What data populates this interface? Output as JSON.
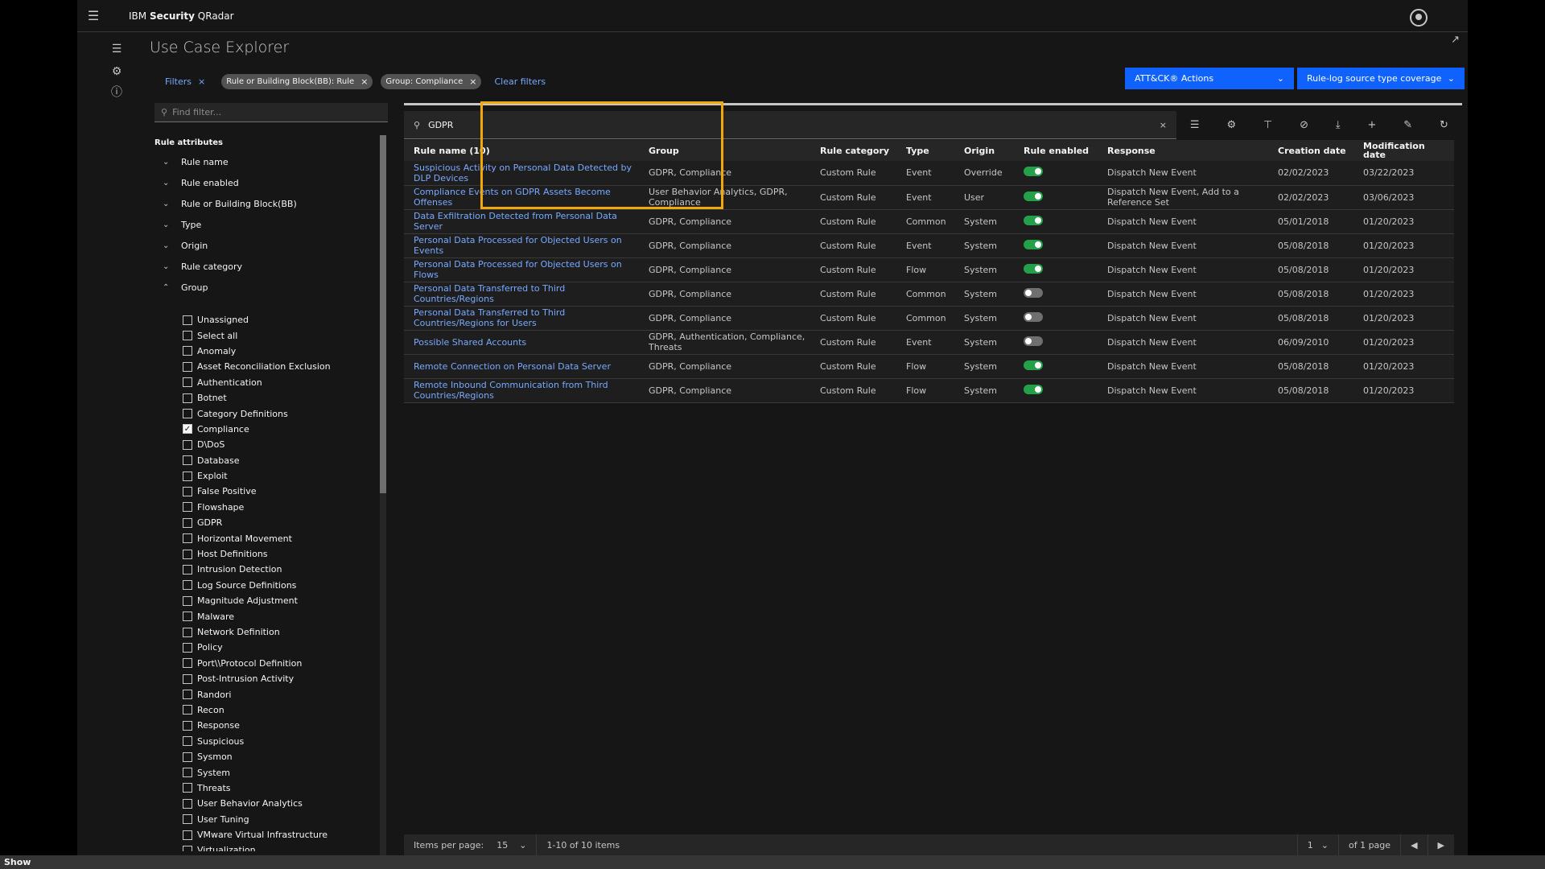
{
  "header": {
    "brand_prefix": "IBM ",
    "brand_bold": "Security",
    "brand_suffix": " QRadar"
  },
  "page": {
    "title": "Use Case Explorer"
  },
  "filters": {
    "label": "Filters",
    "tags": [
      "Rule or Building Block(BB): Rule",
      "Group: Compliance"
    ],
    "clear": "Clear filters"
  },
  "actions": {
    "attack": "ATT&CK® Actions",
    "coverage": "Rule-log source type coverage"
  },
  "sidebar": {
    "find_placeholder": "Find filter...",
    "title": "Rule attributes",
    "attributes": [
      "Rule name",
      "Rule enabled",
      "Rule or Building Block(BB)",
      "Type",
      "Origin",
      "Rule category",
      "Group"
    ],
    "groups": [
      {
        "label": "Unassigned",
        "checked": false
      },
      {
        "label": "Select all",
        "checked": false
      },
      {
        "label": "Anomaly",
        "checked": false
      },
      {
        "label": "Asset Reconciliation Exclusion",
        "checked": false
      },
      {
        "label": "Authentication",
        "checked": false
      },
      {
        "label": "Botnet",
        "checked": false
      },
      {
        "label": "Category Definitions",
        "checked": false
      },
      {
        "label": "Compliance",
        "checked": true
      },
      {
        "label": "D\\DoS",
        "checked": false
      },
      {
        "label": "Database",
        "checked": false
      },
      {
        "label": "Exploit",
        "checked": false
      },
      {
        "label": "False Positive",
        "checked": false
      },
      {
        "label": "Flowshape",
        "checked": false
      },
      {
        "label": "GDPR",
        "checked": false
      },
      {
        "label": "Horizontal Movement",
        "checked": false
      },
      {
        "label": "Host Definitions",
        "checked": false
      },
      {
        "label": "Intrusion Detection",
        "checked": false
      },
      {
        "label": "Log Source Definitions",
        "checked": false
      },
      {
        "label": "Magnitude Adjustment",
        "checked": false
      },
      {
        "label": "Malware",
        "checked": false
      },
      {
        "label": "Network Definition",
        "checked": false
      },
      {
        "label": "Policy",
        "checked": false
      },
      {
        "label": "Port\\\\Protocol Definition",
        "checked": false
      },
      {
        "label": "Post-Intrusion Activity",
        "checked": false
      },
      {
        "label": "Randori",
        "checked": false
      },
      {
        "label": "Recon",
        "checked": false
      },
      {
        "label": "Response",
        "checked": false
      },
      {
        "label": "Suspicious",
        "checked": false
      },
      {
        "label": "Sysmon",
        "checked": false
      },
      {
        "label": "System",
        "checked": false
      },
      {
        "label": "Threats",
        "checked": false
      },
      {
        "label": "User Behavior Analytics",
        "checked": false
      },
      {
        "label": "User Tuning",
        "checked": false
      },
      {
        "label": "VMware Virtual Infrastructure",
        "checked": false
      },
      {
        "label": "Virtualization",
        "checked": false
      }
    ]
  },
  "search": {
    "value": "GDPR"
  },
  "table": {
    "columns": [
      "Rule name (10)",
      "Group",
      "Rule category",
      "Type",
      "Origin",
      "Rule enabled",
      "Response",
      "Creation date",
      "Modification date"
    ],
    "rows": [
      {
        "name": "Suspicious Activity on Personal Data Detected by DLP Devices",
        "group": "GDPR, Compliance",
        "category": "Custom Rule",
        "type": "Event",
        "origin": "Override",
        "enabled": true,
        "response": "Dispatch New Event",
        "created": "02/02/2023",
        "modified": "03/22/2023"
      },
      {
        "name": "Compliance Events on GDPR Assets Become Offenses",
        "group": "User Behavior Analytics, GDPR, Compliance",
        "category": "Custom Rule",
        "type": "Event",
        "origin": "User",
        "enabled": true,
        "response": "Dispatch New Event, Add to a Reference Set",
        "created": "02/02/2023",
        "modified": "03/06/2023"
      },
      {
        "name": "Data Exfiltration Detected from Personal Data Server",
        "group": "GDPR, Compliance",
        "category": "Custom Rule",
        "type": "Common",
        "origin": "System",
        "enabled": true,
        "response": "Dispatch New Event",
        "created": "05/01/2018",
        "modified": "01/20/2023"
      },
      {
        "name": "Personal Data Processed for Objected Users on Events",
        "group": "GDPR, Compliance",
        "category": "Custom Rule",
        "type": "Event",
        "origin": "System",
        "enabled": true,
        "response": "Dispatch New Event",
        "created": "05/08/2018",
        "modified": "01/20/2023"
      },
      {
        "name": "Personal Data Processed for Objected Users on Flows",
        "group": "GDPR, Compliance",
        "category": "Custom Rule",
        "type": "Flow",
        "origin": "System",
        "enabled": true,
        "response": "Dispatch New Event",
        "created": "05/08/2018",
        "modified": "01/20/2023"
      },
      {
        "name": "Personal Data Transferred to Third Countries/Regions",
        "group": "GDPR, Compliance",
        "category": "Custom Rule",
        "type": "Common",
        "origin": "System",
        "enabled": false,
        "response": "Dispatch New Event",
        "created": "05/08/2018",
        "modified": "01/20/2023"
      },
      {
        "name": "Personal Data Transferred to Third Countries/Regions for Users",
        "group": "GDPR, Compliance",
        "category": "Custom Rule",
        "type": "Common",
        "origin": "System",
        "enabled": false,
        "response": "Dispatch New Event",
        "created": "05/08/2018",
        "modified": "01/20/2023"
      },
      {
        "name": "Possible Shared Accounts",
        "group": "GDPR, Authentication, Compliance, Threats",
        "category": "Custom Rule",
        "type": "Event",
        "origin": "System",
        "enabled": false,
        "response": "Dispatch New Event",
        "created": "06/09/2010",
        "modified": "01/20/2023"
      },
      {
        "name": "Remote Connection on Personal Data Server",
        "group": "GDPR, Compliance",
        "category": "Custom Rule",
        "type": "Flow",
        "origin": "System",
        "enabled": true,
        "response": "Dispatch New Event",
        "created": "05/08/2018",
        "modified": "01/20/2023"
      },
      {
        "name": "Remote Inbound Communication from Third Countries/Regions",
        "group": "GDPR, Compliance",
        "category": "Custom Rule",
        "type": "Flow",
        "origin": "System",
        "enabled": true,
        "response": "Dispatch New Event",
        "created": "05/08/2018",
        "modified": "01/20/2023"
      }
    ]
  },
  "pagination": {
    "items_per_page_label": "Items per page:",
    "items_per_page": "15",
    "range": "1-10 of 10 items",
    "page": "1",
    "of_pages": "of 1 page"
  },
  "bottom": {
    "show": "Show"
  },
  "colors": {
    "accent": "#0f62fe",
    "link": "#78a9ff",
    "toggle_on": "#24a148",
    "highlight": "#f1a80c"
  }
}
